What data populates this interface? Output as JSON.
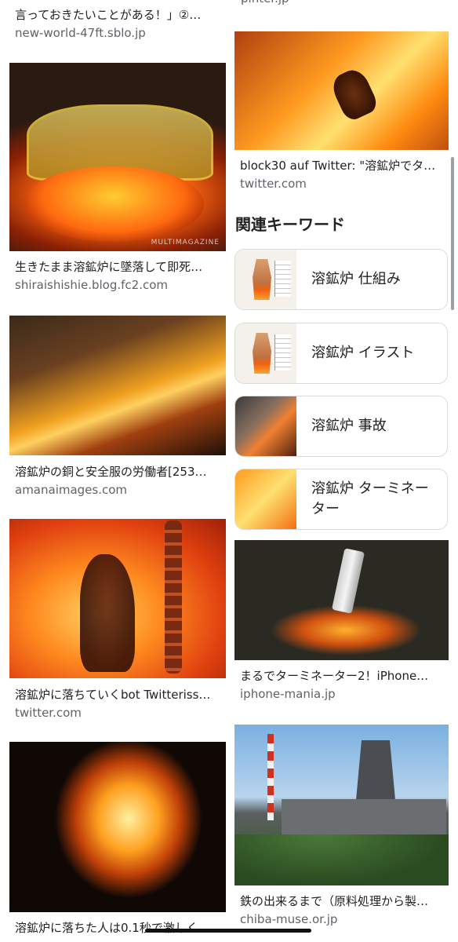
{
  "left_column": [
    {
      "title": "言っておきたいことがある！」②…",
      "source": "new-world-47ft.sblo.jp"
    },
    {
      "title": "生きたまま溶鉱炉に墜落して即死…",
      "source": "shiraishishie.blog.fc2.com",
      "watermark": "MULTIMAGAZINE"
    },
    {
      "title": "溶鉱炉の銅と安全服の労働者[253…",
      "source": "amanaimages.com"
    },
    {
      "title": "溶鉱炉に落ちていくbot Twitteriss…",
      "source": "twitter.com"
    },
    {
      "title": "溶鉱炉に落ちた人は0.1秒で激しく…",
      "source": ""
    }
  ],
  "right_column": {
    "top_source_fragment": "pinter.jp",
    "cards": [
      {
        "title": "block30 auf Twitter: \"溶鉱炉でタ…",
        "source": "twitter.com"
      },
      {
        "title": "まるでターミネーター2！iPhone…",
        "source": "iphone-mania.jp"
      },
      {
        "title": "鉄の出来るまで（原料処理から製…",
        "source": "chiba-muse.or.jp"
      }
    ],
    "keywords_heading": "関連キーワード",
    "keywords": [
      {
        "label": "溶鉱炉 仕組み",
        "icon": "blast-furnace-diagram"
      },
      {
        "label": "溶鉱炉 イラスト",
        "icon": "blast-furnace-diagram"
      },
      {
        "label": "溶鉱炉 事故",
        "icon": "accident-photo"
      },
      {
        "label": "溶鉱炉 ターミネーター",
        "icon": "terminator-photo"
      }
    ]
  },
  "colors": {
    "title": "#202124",
    "source": "#5f6368",
    "chip_border": "#dadce0",
    "background": "#ffffff"
  }
}
